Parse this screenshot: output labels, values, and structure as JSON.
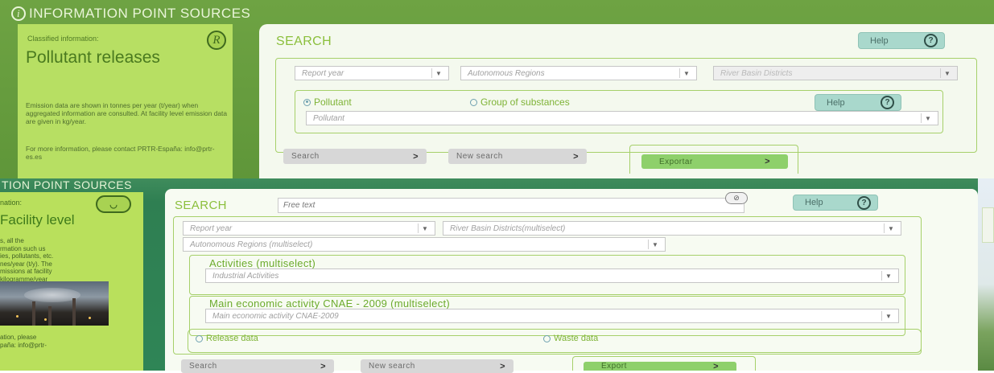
{
  "panel1": {
    "title": "INFORMATION POINT SOURCES",
    "classified": "Classified information:",
    "r_icon": "R",
    "heading": "Pollutant releases",
    "description": "Emission data are shown in tonnes per year (t/year) when aggregated information are consulted. At facility level emission data are given in kg/year.",
    "more_info": "For more information, please contact PRTR-España: info@prtr-es.es",
    "search_title": "SEARCH",
    "help": "Help",
    "selects": {
      "report_year": "Report year",
      "autonomous_regions": "Autonomous Regions",
      "river_basin": "River Basin Districts"
    },
    "radio_pollutant": "Pollutant",
    "radio_group": "Group of substances",
    "pollutant_select": "Pollutant",
    "search_btn": "Search",
    "new_search_btn": "New search",
    "export_btn": "Exportar"
  },
  "panel2": {
    "title": "TION POINT SOURCES",
    "nation": "nation:",
    "heading": "Facility level",
    "description": "s, all the\nrmation such us\nies, pollutants, etc.\nnes/year (t/y). The\nmissions at facility\nkilogramme/year",
    "more_info": "ation, please\npaña: info@prtr-",
    "search_title": "SEARCH",
    "free_text": "Free text",
    "help": "Help",
    "selects": {
      "report_year": "Report year",
      "river_basin": "River Basin Districts(multiselect)",
      "autonomous_regions": "Autonomous Regions (multiselect)",
      "activities": "Industrial Activities",
      "cnae": "Main economic activity CNAE-2009"
    },
    "activities_label": "Activities (multiselect)",
    "cnae_label": "Main economic activity CNAE - 2009 (multiselect)",
    "radio_release": "Release data",
    "radio_waste": "Waste data",
    "search_btn": "Search",
    "new_search_btn": "New search",
    "export_btn": "Export"
  },
  "icons": {
    "chevron": ">",
    "dropdown": "▼",
    "help": "?",
    "info": "i",
    "search": "⊘"
  },
  "colors": {
    "accent_green": "#8bbf3c",
    "sidebar_green": "#b7df63",
    "help_teal": "#a9d8cc",
    "export_green": "#8ed06b"
  }
}
